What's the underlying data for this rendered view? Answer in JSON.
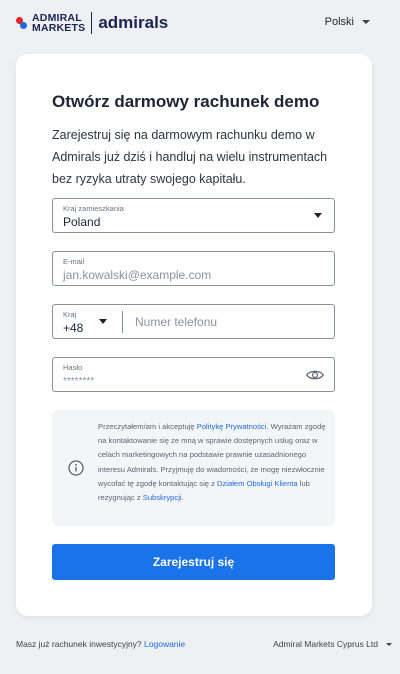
{
  "header": {
    "logo_line1": "ADMIRAL",
    "logo_line2": "MARKETS",
    "logo_brand": "admirals",
    "language": "Polski"
  },
  "form": {
    "title": "Otwórz darmowy rachunek demo",
    "description": "Zarejestruj się na darmowym rachunku demo w Admirals już dziś i handluj na wielu instrumentach bez ryzyka utraty swojego kapitału.",
    "country_label": "Kraj zamieszkania",
    "country_value": "Poland",
    "email_label": "E-mail",
    "email_placeholder": "jan.kowalski@example.com",
    "phone_code_label": "Kraj",
    "phone_code_value": "+48",
    "phone_placeholder": "Numer telefonu",
    "password_label": "Hasło",
    "password_placeholder": "********",
    "submit_label": "Zarejestruj się"
  },
  "consent": {
    "part1": "Przeczytałem/am i akceptuję ",
    "privacy_link": "Politykę Prywatności",
    "part2": ". Wyrażam zgodę na kontaktowanie się ze mną w sprawie dostępnych usług oraz w celach marketingowych na podstawie prawnie uzasadnionego interesu Admirals. Przyjmuję do wiadomości, że mogę niezwłocznie wycofać tę zgodę kontaktując się z ",
    "support_link": "Działem Obsługi Klienta",
    "part3": " lub rezygnując z ",
    "subscriptions_link": "Subskrypcji",
    "part4": "."
  },
  "footer": {
    "question": "Masz już rachunek inwestycyjny? ",
    "login_link": "Logowanie",
    "entity": "Admiral Markets Cyprus Ltd"
  },
  "colors": {
    "primary": "#1a73e8",
    "brand_red": "#e3232f",
    "brand_navy": "#1b2552"
  }
}
